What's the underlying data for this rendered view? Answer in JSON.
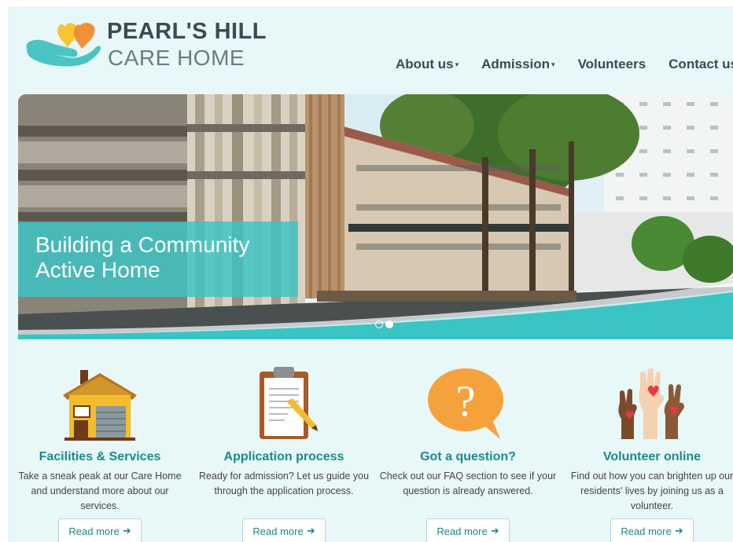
{
  "brand": {
    "line1": "PEARL'S HILL",
    "line2": "CARE HOME"
  },
  "nav": [
    {
      "label": "About us",
      "caret": "▾"
    },
    {
      "label": "Admission",
      "caret": "▾"
    },
    {
      "label": "Volunteers",
      "caret": ""
    },
    {
      "label": "Contact us",
      "caret": ""
    }
  ],
  "hero": {
    "caption_line1": "Building a Community",
    "caption_line2": "Active Home",
    "slides": 2,
    "active_slide": 2
  },
  "features": [
    {
      "icon": "house-icon",
      "title": "Facilities & Services",
      "desc": "Take a sneak peak at our Care Home and understand more about our services.",
      "button": "Read more"
    },
    {
      "icon": "clipboard-icon",
      "title": "Application process",
      "desc": "Ready for admission? Let us guide you through the application process.",
      "button": "Read more"
    },
    {
      "icon": "question-bubble-icon",
      "title": "Got a question?",
      "desc": "Check out our FAQ section to see if your question is already answered.",
      "button": "Read more"
    },
    {
      "icon": "raised-hands-icon",
      "title": "Volunteer online",
      "desc": "Find out how you can brighten up our residents' lives by joining us as a volunteer.",
      "button": "Read more"
    }
  ],
  "colors": {
    "accent": "#1b8a8a",
    "teal": "#3ac4c4",
    "background": "#e8f7f7",
    "heart_yellow": "#f7c531",
    "heart_orange": "#f08a2c"
  }
}
